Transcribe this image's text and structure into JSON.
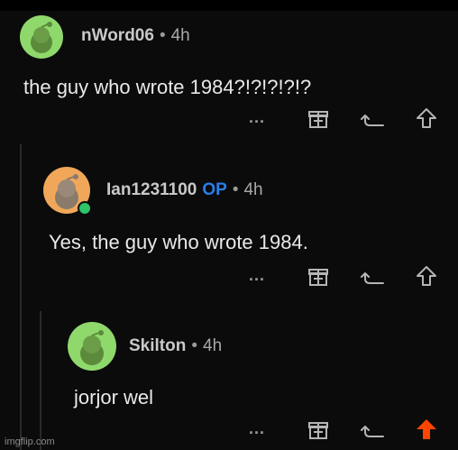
{
  "comments": [
    {
      "username": "nWord06",
      "op_badge": "",
      "separator": "•",
      "time": "4h",
      "body": "the guy who wrote 1984?!?!?!?!?",
      "more": "..."
    },
    {
      "username": "Ian1231100",
      "op_badge": "OP",
      "separator": "•",
      "time": "4h",
      "body": "Yes, the guy who wrote 1984.",
      "more": "..."
    },
    {
      "username": "Skilton",
      "op_badge": "",
      "separator": "•",
      "time": "4h",
      "body": "jorjor wel",
      "more": "..."
    }
  ],
  "icons": {
    "more": "more-options-icon",
    "award": "award-gift-icon",
    "reply": "reply-icon",
    "upvote": "upvote-icon"
  },
  "colors": {
    "background": "#0b0b0b",
    "op_badge": "#2a7ee8",
    "avatar_green": "#8fd86b",
    "avatar_orange": "#f0a75a",
    "upvoted": "#ff4500",
    "online": "#2cc36b"
  },
  "watermark": "imgflip.com"
}
